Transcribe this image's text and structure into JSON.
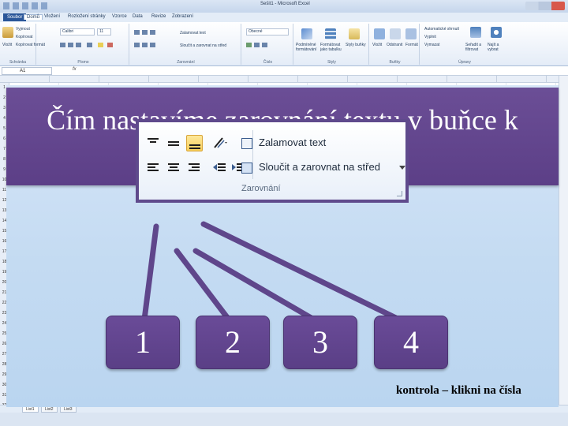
{
  "excel": {
    "title": "Sešit1 - Microsoft Excel",
    "tabs": [
      "Soubor",
      "Domů",
      "Vložení",
      "Rozložení stránky",
      "Vzorce",
      "Data",
      "Revize",
      "Zobrazení"
    ],
    "ribbon_groups": {
      "clipboard": "Schránka",
      "font": "Písmo",
      "alignment": "Zarovnání",
      "number": "Číslo",
      "styles": "Styly",
      "cells": "Buňky",
      "editing": "Úpravy"
    },
    "clipboard_items": [
      "Vyjmout",
      "Kopírovat",
      "Kopírovat formát"
    ],
    "paste_label": "Vložit",
    "font_name": "Calibri",
    "font_size": "11",
    "wrap_small": "Zalamovat text",
    "merge_small": "Sloučit a zarovnat na střed",
    "number_format": "Obecné",
    "styles_items": [
      "Podmíněné formátování",
      "Formátovat jako tabulku",
      "Styly buňky"
    ],
    "cells_items": [
      "Vložit",
      "Odstranit",
      "Formát"
    ],
    "editing_items": [
      "Automatické shrnutí",
      "Vyplnit",
      "Vymazat",
      "Seřadit a filtrovat",
      "Najít a vybrat"
    ],
    "name_box": "A1",
    "fx": "fx",
    "row_numbers": [
      "1",
      "2",
      "3",
      "4",
      "5",
      "6",
      "7",
      "8",
      "9",
      "10",
      "11",
      "12",
      "13",
      "14",
      "15",
      "16",
      "17",
      "18",
      "19",
      "20",
      "21",
      "22",
      "23",
      "24",
      "25",
      "26",
      "27",
      "28",
      "29",
      "30",
      "31",
      "32"
    ],
    "sheets": [
      "List1",
      "List2",
      "List3"
    ]
  },
  "slide": {
    "question": "Čím nastavíme zarovnání textu v buňce k hornímu okraji?",
    "zoom": {
      "wrap_text": "Zalamovat text",
      "merge_center": "Sloučit a zarovnat na střed",
      "group_label": "Zarovnání"
    },
    "answers": [
      "1",
      "2",
      "3",
      "4"
    ],
    "check_label": "kontrola – klikni na čísla"
  },
  "colors": {
    "accent_purple": "#5c3f87",
    "slide_bg": "#c4dbf2",
    "highlight_yellow": "#f8cf5b"
  }
}
